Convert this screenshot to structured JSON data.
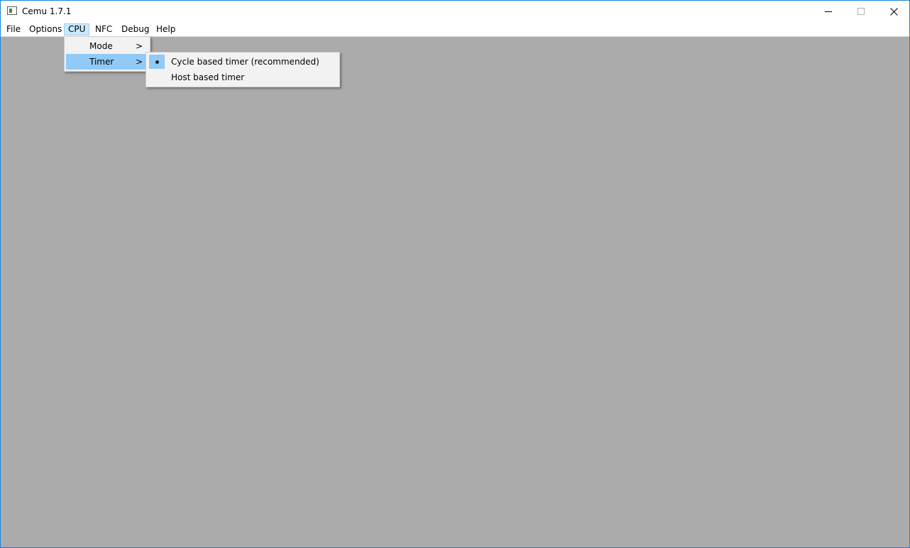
{
  "window": {
    "title": "Cemu 1.7.1",
    "icon": "app-icon"
  },
  "titlebar_buttons": {
    "minimize_icon": "minimize-icon",
    "maximize_icon": "maximize-icon",
    "close_icon": "close-icon"
  },
  "menubar": {
    "items": [
      {
        "label": "File"
      },
      {
        "label": "Options"
      },
      {
        "label": "CPU"
      },
      {
        "label": "NFC"
      },
      {
        "label": "Debug"
      },
      {
        "label": "Help"
      }
    ],
    "open_menu": "CPU"
  },
  "cpu_menu": {
    "items": [
      {
        "label": "Mode",
        "submenu_glyph": ">"
      },
      {
        "label": "Timer",
        "submenu_glyph": ">"
      }
    ],
    "highlighted": "Timer"
  },
  "timer_submenu": {
    "items": [
      {
        "label": "Cycle based timer (recommended)",
        "selected": true
      },
      {
        "label": "Host based timer",
        "selected": false
      }
    ]
  },
  "colors": {
    "client_background": "#ababab",
    "highlight": "#91c9f7",
    "open_menu_background": "#cce8ff",
    "window_border": "#1883d7"
  }
}
